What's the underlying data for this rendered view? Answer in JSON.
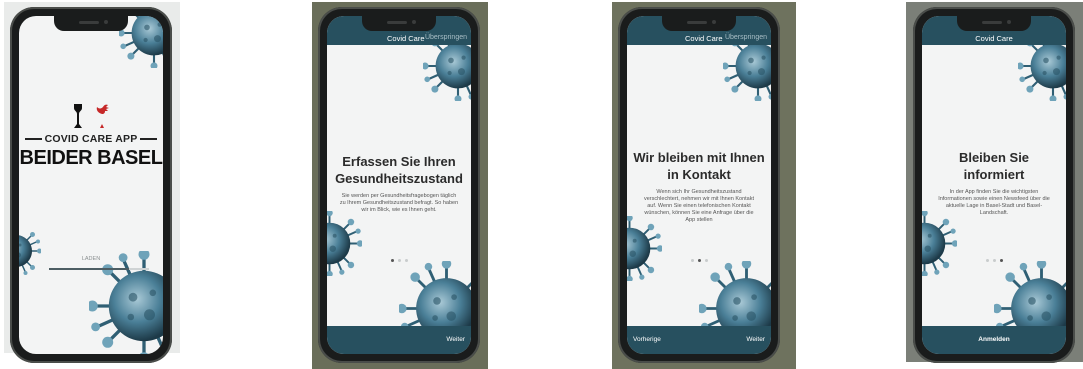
{
  "colors": {
    "bar": "#27505f",
    "screen": "#f3f4f4",
    "virus": "#4a7f97"
  },
  "phone1": {
    "brand_line": "COVID CARE APP",
    "brand_big": "BEIDER BASEL",
    "loading_label": "LADEN",
    "progress_fraction": 0.8,
    "icons": [
      "basel-stadt-crest-icon",
      "basel-landschaft-crest-icon"
    ]
  },
  "phone2": {
    "header_title": "Covid Care",
    "header_skip": "Überspringen",
    "title": "Erfassen Sie Ihren Gesundheitszustand",
    "text": "Sie werden per Gesundheitsfragebogen täglich zu Ihrem Gesundheitszustand befragt. So haben wir im Blick, wie es Ihnen geht.",
    "active_dot": 1,
    "next_label": "Weiter"
  },
  "phone3": {
    "header_title": "Covid Care",
    "header_skip": "Überspringen",
    "title": "Wir bleiben mit Ihnen in Kontakt",
    "text": "Wenn sich Ihr Gesundheitszustand verschlechtert, nehmen wir mit Ihnen Kontakt auf. Wenn Sie einen telefonischen Kontakt wünschen, können Sie eine Anfrage über die App stellen",
    "active_dot": 2,
    "prev_label": "Vorherige",
    "next_label": "Weiter"
  },
  "phone4": {
    "header_title": "Covid Care",
    "title": "Bleiben Sie informiert",
    "text": "In der App finden Sie die wichtigsten Informationen sowie einen Newsfeed über die aktuelle Lage in Basel-Stadt und Basel-Landschaft.",
    "active_dot": 3,
    "login_label": "Anmelden"
  }
}
